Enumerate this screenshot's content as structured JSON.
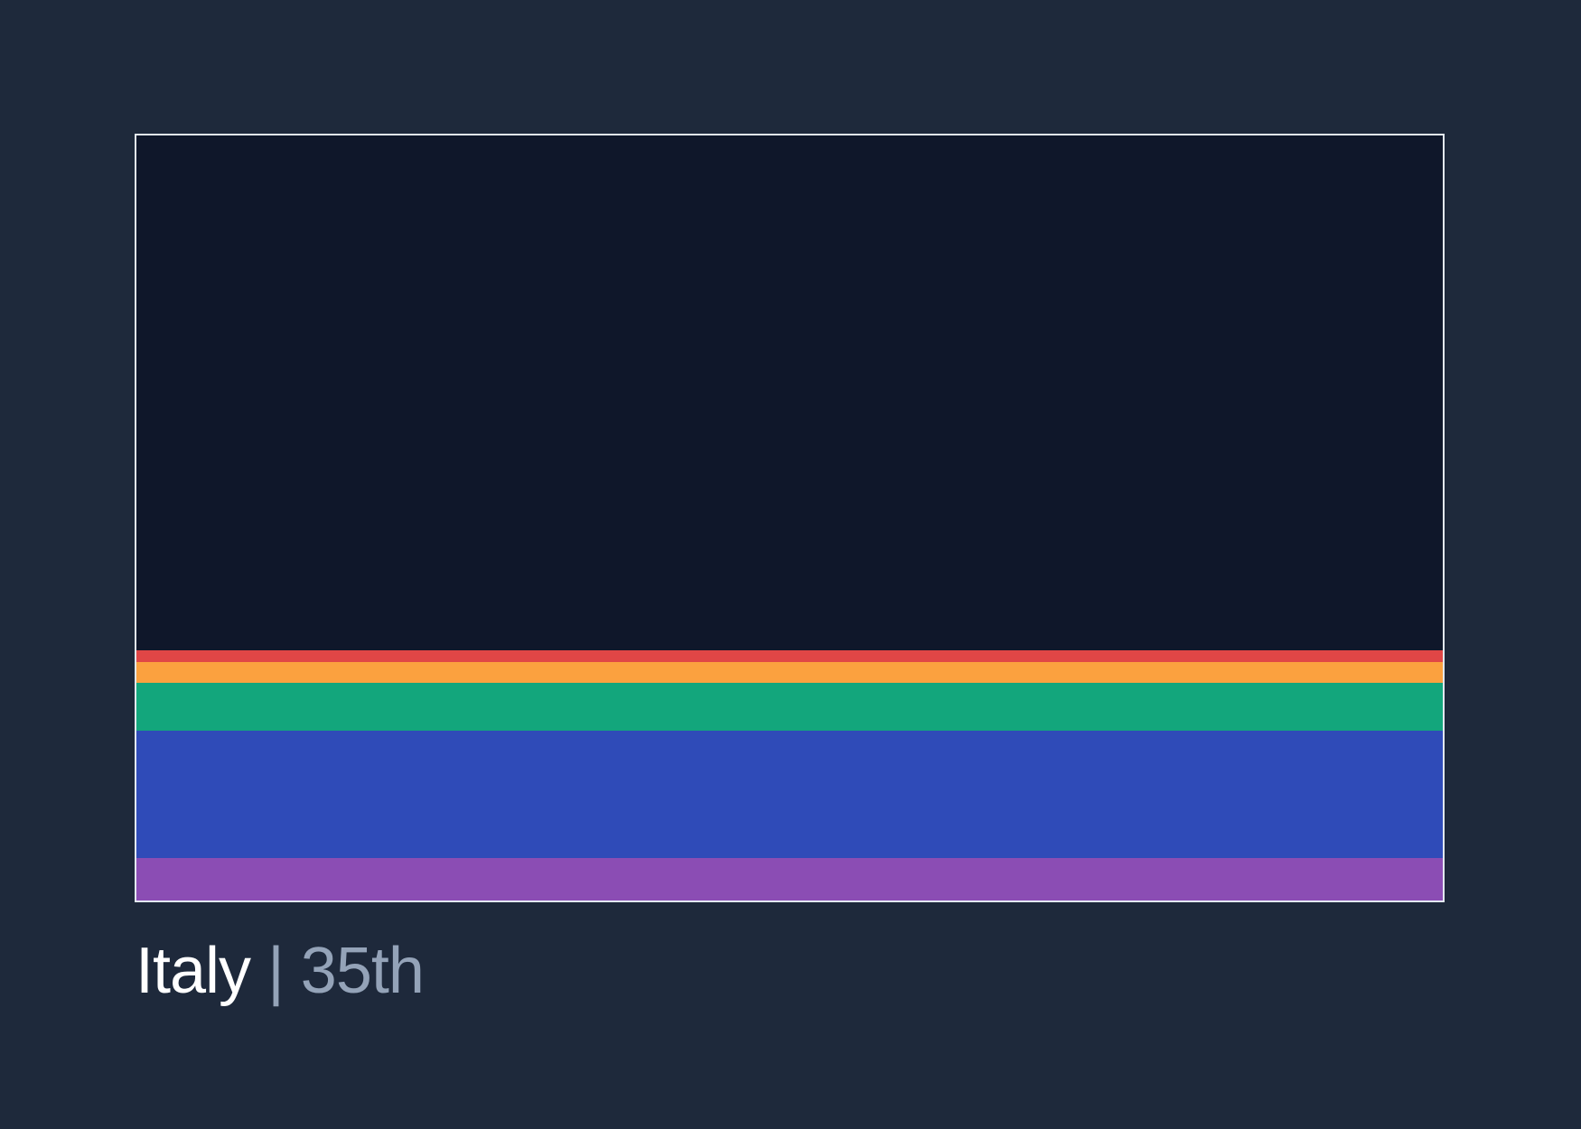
{
  "card": {
    "background": "#0f172a",
    "border_color": "#e2e8f0",
    "bands": [
      {
        "name": "red",
        "color": "#e04646",
        "share": 0.015
      },
      {
        "name": "orange",
        "color": "#fba13f",
        "share": 0.027
      },
      {
        "name": "green",
        "color": "#13a67c",
        "share": 0.062
      },
      {
        "name": "blue",
        "color": "#2f4bb8",
        "share": 0.167
      },
      {
        "name": "purple",
        "color": "#8b4db4",
        "share": 0.055
      }
    ]
  },
  "caption": {
    "country": "Italy",
    "separator": "|",
    "rank": "35th"
  }
}
